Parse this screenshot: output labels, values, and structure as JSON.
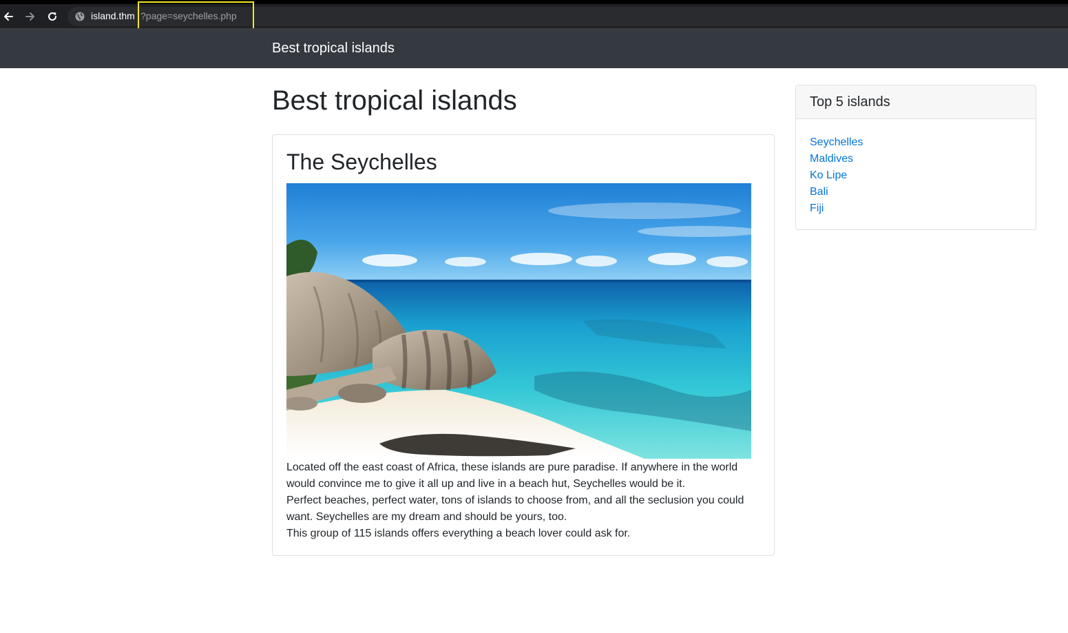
{
  "browser": {
    "back_icon": "arrow-left-icon",
    "forward_icon": "arrow-right-icon",
    "reload_icon": "reload-icon",
    "site_icon": "globe-icon",
    "url_host": "island.thm",
    "url_query": "?page=seychelles.php",
    "highlight_color": "#f2ea1f"
  },
  "navbar": {
    "brand": "Best tropical islands",
    "background": "#343a40"
  },
  "main": {
    "heading": "Best tropical islands",
    "article": {
      "title": "The Seychelles",
      "paragraphs": [
        "Located off the east coast of Africa, these islands are pure paradise. If anywhere in the world would convince me to give it all up and live in a beach hut, Seychelles would be it.",
        "Perfect beaches, perfect water, tons of islands to choose from, and all the seclusion you could want. Seychelles are my dream and should be yours, too.",
        "This group of 115 islands offers everything a beach lover could ask for."
      ]
    }
  },
  "sidebar": {
    "title": "Top 5 islands",
    "links": [
      "Seychelles",
      "Maldives",
      "Ko Lipe",
      "Bali",
      "Fiji"
    ],
    "link_color": "#0275d8"
  }
}
